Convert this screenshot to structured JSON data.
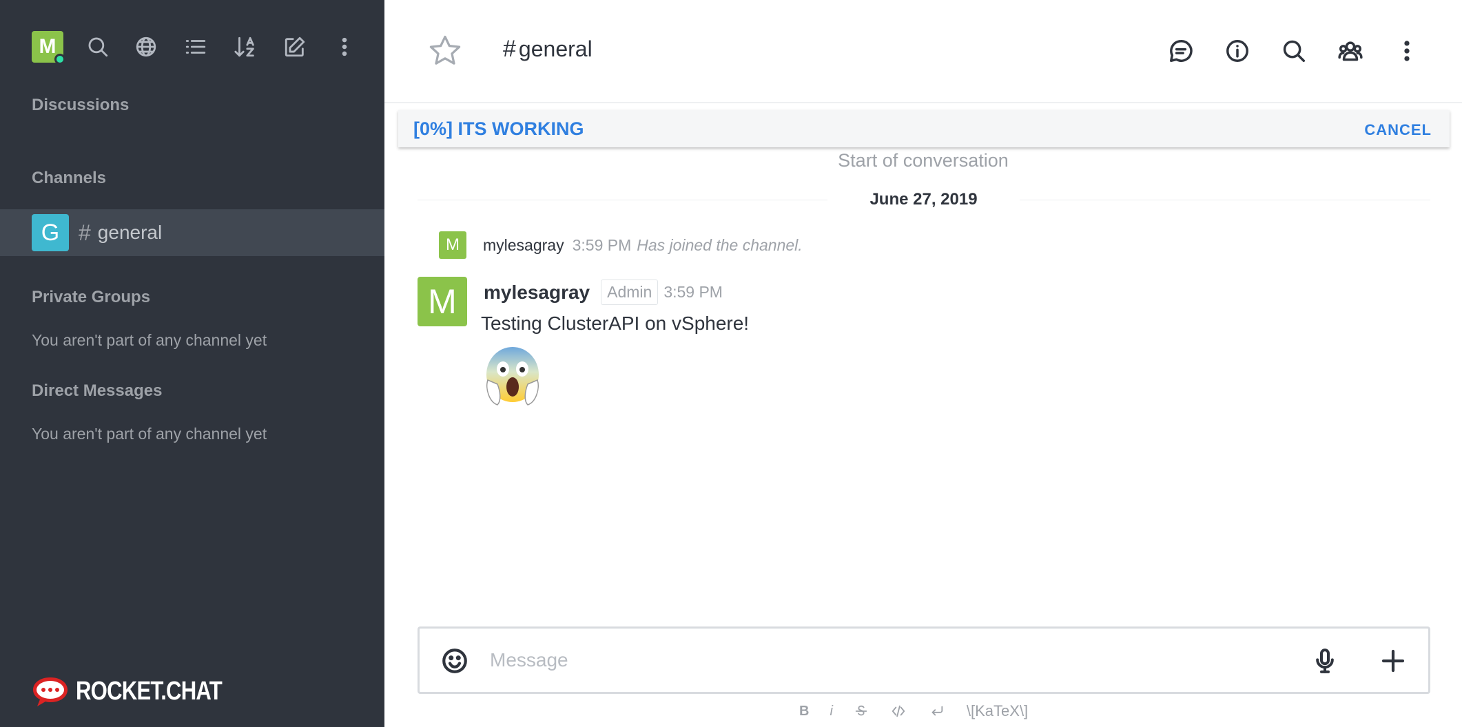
{
  "user": {
    "avatar_letter": "M",
    "status": "online"
  },
  "sidebar": {
    "toolbar_icons": [
      "search-icon",
      "directory-globe-icon",
      "view-list-icon",
      "sort-az-icon",
      "create-new-icon",
      "kebab-menu-icon"
    ],
    "sections": {
      "discussions": "Discussions",
      "channels": "Channels",
      "private_groups": "Private Groups",
      "direct_messages": "Direct Messages"
    },
    "channel": {
      "avatar_letter": "G",
      "hash": "#",
      "name": "general"
    },
    "private_groups_empty": "You aren't part of any channel yet",
    "direct_messages_empty": "You aren't part of any channel yet",
    "brand": "ROCKET.CHAT"
  },
  "header": {
    "hash": "#",
    "room_name": "general",
    "icons": [
      "discussion-icon",
      "info-icon",
      "search-icon",
      "members-icon",
      "kebab-menu-icon"
    ]
  },
  "upload": {
    "text": "[0%] ITS WORKING",
    "cancel_label": "CANCEL"
  },
  "conversation": {
    "start_label": "Start of conversation",
    "date": "June 27, 2019",
    "system_message": {
      "avatar_letter": "M",
      "username": "mylesagray",
      "time": "3:59 PM",
      "text": "Has joined the channel."
    },
    "message": {
      "avatar_letter": "M",
      "username": "mylesagray",
      "role": "Admin",
      "time": "3:59 PM",
      "text": "Testing ClusterAPI on vSphere!",
      "emoji": "scream-emoji"
    }
  },
  "composer": {
    "placeholder": "Message",
    "value": "",
    "formatting": {
      "bold": "B",
      "italic": "i",
      "katex": "\\[KaTeX\\]"
    }
  },
  "colors": {
    "sidebar_bg": "#2f343d",
    "sidebar_active": "#414852",
    "accent": "#2f7fe0",
    "avatar_green": "#8bc34a",
    "avatar_cyan": "#3fb8d0",
    "status_online": "#2de0a5",
    "brand_red": "#db2323"
  }
}
